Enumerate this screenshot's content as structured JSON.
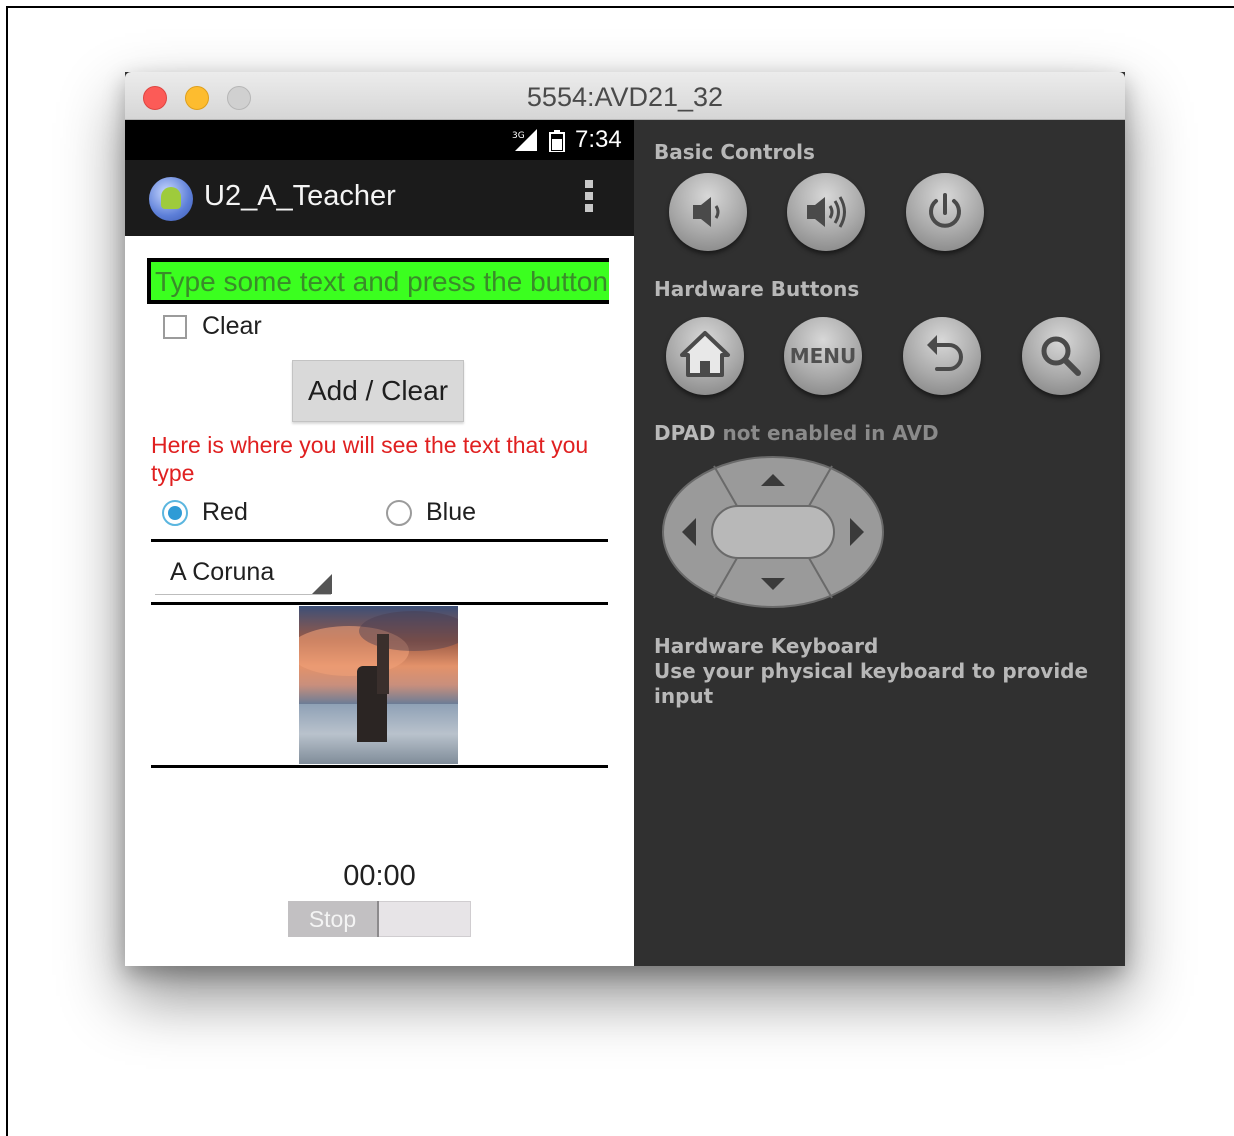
{
  "window": {
    "title": "5554:AVD21_32"
  },
  "phone": {
    "status_bar": {
      "network_label": "3G",
      "time": "7:34"
    },
    "action_bar": {
      "app_title": "U2_A_Teacher",
      "overflow_icon": "overflow-menu-icon"
    },
    "text_input": {
      "value": "Type some text and press the button",
      "background_color": "#3bff1f"
    },
    "checkbox": {
      "label": "Clear",
      "checked": false
    },
    "add_clear_button": {
      "label": "Add / Clear"
    },
    "output_text": {
      "text": "Here is where you will see the text that you type",
      "color": "#e02020"
    },
    "radio_group": {
      "options": [
        {
          "label": "Red",
          "selected": true
        },
        {
          "label": "Blue",
          "selected": false
        }
      ]
    },
    "spinner": {
      "selected_value": "A Coruna"
    },
    "image": {
      "icon": "landscape-photo"
    },
    "timer": {
      "value": "00:00"
    },
    "stop_toggle": {
      "label": "Stop"
    }
  },
  "controls": {
    "basic_controls": {
      "title": "Basic Controls",
      "buttons": [
        {
          "icon": "volume-down-icon"
        },
        {
          "icon": "volume-up-icon"
        },
        {
          "icon": "power-icon"
        }
      ]
    },
    "hardware_buttons": {
      "title": "Hardware Buttons",
      "buttons": [
        {
          "icon": "home-icon"
        },
        {
          "icon": "menu-button",
          "label": "MENU"
        },
        {
          "icon": "back-icon"
        },
        {
          "icon": "search-icon"
        }
      ]
    },
    "dpad": {
      "title_bold": "DPAD",
      "title_rest": " not enabled in AVD"
    },
    "keyboard": {
      "title": "Hardware Keyboard",
      "description": "Use your physical keyboard to provide input"
    }
  }
}
